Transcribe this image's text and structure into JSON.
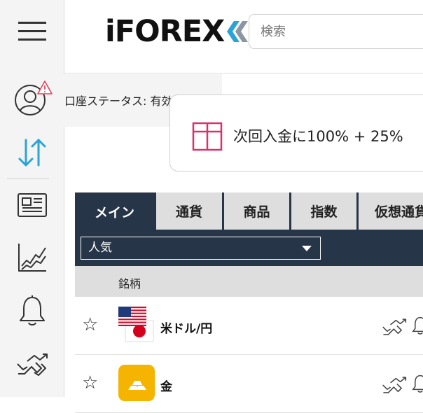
{
  "header": {
    "logo_text": "iFOREX",
    "search_placeholder": "検索"
  },
  "account": {
    "status_text": "口座ステータス: 有効化前"
  },
  "bonus": {
    "text": "次回入金に100% + 25%"
  },
  "markets": {
    "tabs": [
      {
        "label": "メイン",
        "active": true
      },
      {
        "label": "通貨",
        "active": false
      },
      {
        "label": "商品",
        "active": false
      },
      {
        "label": "指数",
        "active": false
      },
      {
        "label": "仮想通貨",
        "active": false
      }
    ],
    "filter": {
      "selected": "人気"
    },
    "column_header": "銘柄",
    "rows": [
      {
        "name": "米ドル/円",
        "icon": "usd-jpy-flags-icon"
      },
      {
        "name": "金",
        "icon": "gold-bars-icon"
      }
    ]
  },
  "colors": {
    "sidebar_bg": "#f4f4f4",
    "tab_active": "#263547",
    "tab_inactive": "#dedede",
    "accent_blue": "#2aa4d8",
    "warning_red": "#e0435b",
    "gift_pink": "#d8326d",
    "gold": "#f5b400"
  }
}
